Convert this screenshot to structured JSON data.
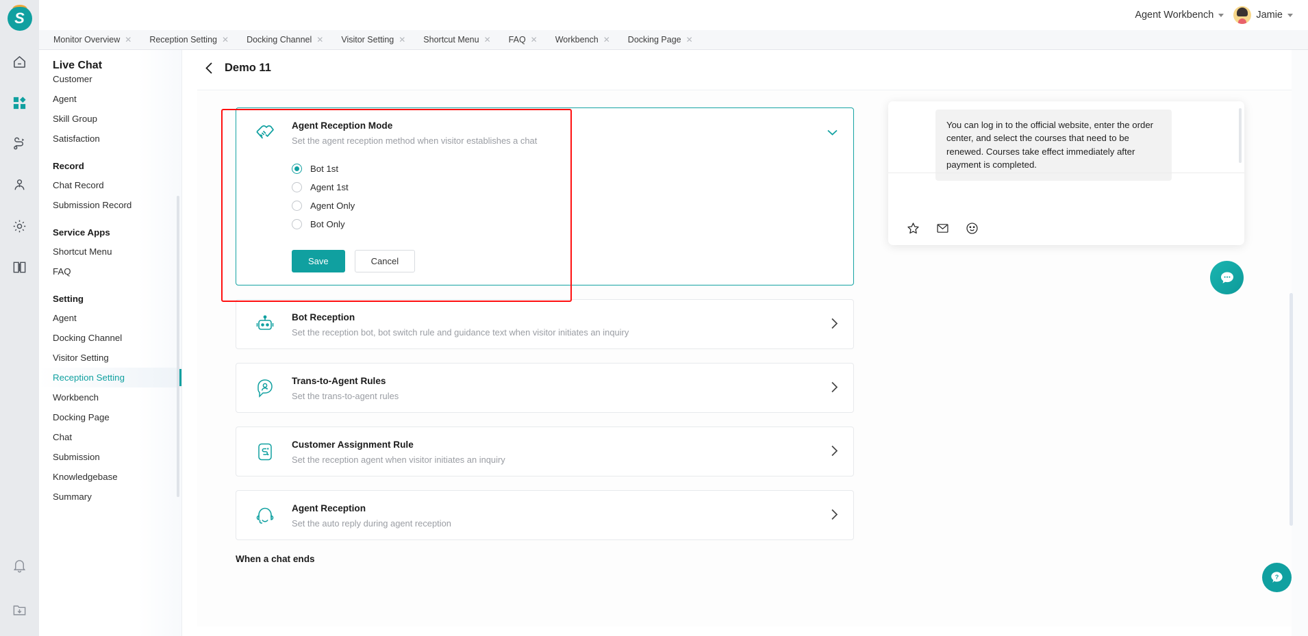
{
  "app": {
    "logo_letter": "S"
  },
  "header": {
    "workbench_label": "Agent Workbench",
    "user_name": "Jamie"
  },
  "tabs": [
    {
      "label": "Monitor Overview",
      "close": "✕"
    },
    {
      "label": "Reception Setting",
      "close": "✕"
    },
    {
      "label": "Docking Channel",
      "close": "✕"
    },
    {
      "label": "Visitor Setting",
      "close": "✕"
    },
    {
      "label": "Shortcut Menu",
      "close": "✕"
    },
    {
      "label": "FAQ",
      "close": "✕"
    },
    {
      "label": "Workbench",
      "close": "✕"
    },
    {
      "label": "Docking Page",
      "close": "✕"
    }
  ],
  "nav": {
    "title": "Live Chat",
    "groups": [
      {
        "label": "",
        "items": [
          {
            "label": "Customer",
            "active": false
          },
          {
            "label": "Agent",
            "active": false
          },
          {
            "label": "Skill Group",
            "active": false
          },
          {
            "label": "Satisfaction",
            "active": false
          }
        ]
      },
      {
        "label": "Record",
        "items": [
          {
            "label": "Chat Record",
            "active": false
          },
          {
            "label": "Submission Record",
            "active": false
          }
        ]
      },
      {
        "label": "Service Apps",
        "items": [
          {
            "label": "Shortcut Menu",
            "active": false
          },
          {
            "label": "FAQ",
            "active": false
          }
        ]
      },
      {
        "label": "Setting",
        "items": [
          {
            "label": "Agent",
            "active": false
          },
          {
            "label": "Docking Channel",
            "active": false
          },
          {
            "label": "Visitor Setting",
            "active": false
          },
          {
            "label": "Reception Setting",
            "active": true
          },
          {
            "label": "Workbench",
            "active": false
          },
          {
            "label": "Docking Page",
            "active": false
          },
          {
            "label": "Chat",
            "active": false
          },
          {
            "label": "Submission",
            "active": false
          },
          {
            "label": "Knowledgebase",
            "active": false
          },
          {
            "label": "Summary",
            "active": false
          }
        ]
      }
    ]
  },
  "page": {
    "title": "Demo 11",
    "section_label": "When a chat ends"
  },
  "reception_mode": {
    "title": "Agent Reception Mode",
    "desc": "Set the agent reception method when visitor establishes a chat",
    "options": [
      {
        "label": "Bot 1st",
        "selected": true
      },
      {
        "label": "Agent 1st",
        "selected": false
      },
      {
        "label": "Agent Only",
        "selected": false
      },
      {
        "label": "Bot Only",
        "selected": false
      }
    ],
    "save_label": "Save",
    "cancel_label": "Cancel"
  },
  "cards": [
    {
      "title": "Bot Reception",
      "desc": "Set the reception bot, bot switch rule and guidance text when visitor initiates an inquiry",
      "icon": "robot-icon"
    },
    {
      "title": "Trans-to-Agent Rules",
      "desc": "Set the trans-to-agent rules",
      "icon": "transfer-agent-icon"
    },
    {
      "title": "Customer Assignment Rule",
      "desc": "Set the reception agent when visitor initiates an inquiry",
      "icon": "assignment-icon"
    },
    {
      "title": "Agent Reception",
      "desc": "Set the auto reply during agent reception",
      "icon": "headset-icon"
    }
  ],
  "chat_widget": {
    "message": "You can log in to the official website, enter the order center, and select the courses that need to be renewed. Courses take effect immediately after payment is completed."
  },
  "colors": {
    "accent": "#10a0a0",
    "annotation": "#ff0f0f",
    "text": "#1b1b1b",
    "muted": "#9a9da3"
  }
}
